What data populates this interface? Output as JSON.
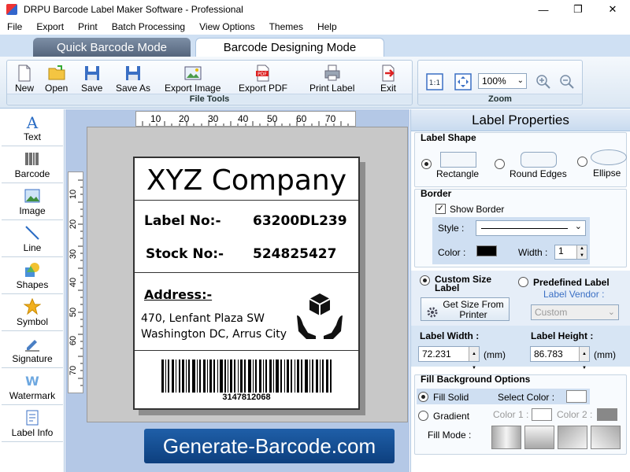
{
  "window": {
    "title": "DRPU Barcode Label Maker Software - Professional",
    "min": "—",
    "restore": "❐",
    "close": "✕"
  },
  "menu": [
    "File",
    "Export",
    "Print",
    "Batch Processing",
    "View Options",
    "Themes",
    "Help"
  ],
  "tabs": {
    "quick": "Quick Barcode Mode",
    "design": "Barcode Designing Mode"
  },
  "toolbar": {
    "file_group": "File Tools",
    "zoom_group": "Zoom",
    "buttons": [
      "New",
      "Open",
      "Save",
      "Save As",
      "Export Image",
      "Export PDF",
      "Print Label",
      "Exit"
    ],
    "zoom_value": "100%",
    "fit_label": "1:1"
  },
  "sidebar": [
    "Text",
    "Barcode",
    "Image",
    "Line",
    "Shapes",
    "Symbol",
    "Signature",
    "Watermark",
    "Label Info"
  ],
  "rulers": {
    "h": [
      "10",
      "20",
      "30",
      "40",
      "50",
      "60",
      "70"
    ],
    "v": [
      "10",
      "20",
      "30",
      "40",
      "50",
      "60",
      "70"
    ]
  },
  "label": {
    "company": "XYZ Company",
    "label_no_key": "Label No:-",
    "label_no_val": "63200DL239",
    "stock_no_key": "Stock No:-",
    "stock_no_val": "524825427",
    "address_title": "Address:-",
    "address_line1": "470, Lenfant Plaza SW",
    "address_line2": "Washington DC, Arrus City",
    "barcode_number": "3147812068"
  },
  "banner": "Generate-Barcode.com",
  "properties": {
    "title": "Label Properties",
    "shape_title": "Label Shape",
    "shapes": [
      "Rectangle",
      "Round Edges",
      "Ellipse"
    ],
    "border_title": "Border",
    "show_border": "Show Border",
    "style_label": "Style :",
    "color_label": "Color :",
    "width_label": "Width :",
    "width_value": "1",
    "custom_size": "Custom Size Label",
    "predefined": "Predefined Label",
    "vendor_label": "Label Vendor :",
    "vendor_value": "Custom",
    "get_size": "Get Size From Printer",
    "label_width": "Label Width :",
    "label_width_value": "72.231",
    "label_height": "Label Height :",
    "label_height_value": "86.783",
    "unit": "(mm)",
    "fill_title": "Fill Background Options",
    "fill_solid": "Fill Solid",
    "select_color": "Select Color :",
    "gradient": "Gradient",
    "color1": "Color 1 :",
    "color2": "Color 2 :",
    "fill_mode": "Fill Mode :"
  }
}
